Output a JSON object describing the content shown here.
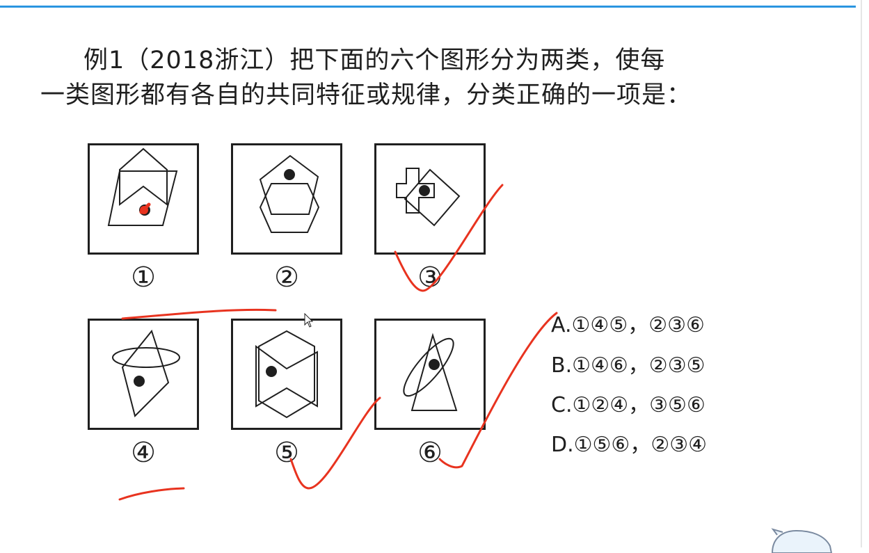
{
  "question": {
    "line1": "例1（2018浙江）把下面的六个图形分为两类，使每",
    "line2": "一类图形都有各自的共同特征或规律，分类正确的一项是："
  },
  "figures": {
    "labels": [
      "①",
      "②",
      "③",
      "④",
      "⑤",
      "⑥"
    ]
  },
  "options": [
    "A.①④⑤，②③⑥",
    "B.①④⑥，②③⑤",
    "C.①②④，③⑤⑥",
    "D.①⑤⑥，②③④"
  ],
  "colors": {
    "ink": "#e8331f",
    "line": "#1f1f1f",
    "top_bar": "#1a8cd8"
  },
  "icons": [
    "mouse-cursor-icon",
    "avatar-mascot-icon"
  ]
}
